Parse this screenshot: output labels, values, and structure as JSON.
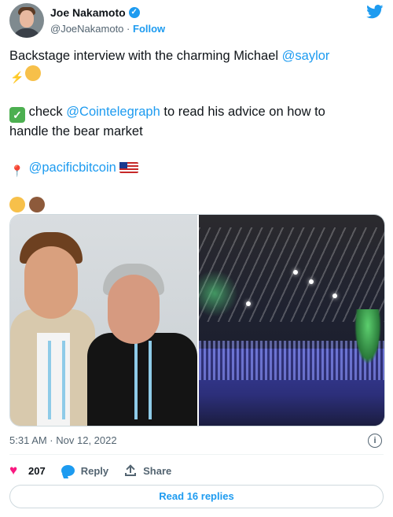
{
  "author": {
    "name": "Joe Nakamoto",
    "handle": "@JoeNakamoto",
    "separator": "·",
    "follow_label": "Follow"
  },
  "icons": {
    "verified": "verified-badge-icon",
    "brand": "twitter-bird-icon",
    "info": "info-icon",
    "like": "heart-icon",
    "reply": "reply-bubble-icon",
    "share": "share-icon"
  },
  "tweet": {
    "line1_text": "Backstage interview with the charming Michael ",
    "line1_mention": "@saylor",
    "line3_text_a": " check ",
    "line3_mention": "@Cointelegraph",
    "line3_text_b": " to read his advice on how to",
    "line4_text": "handle the bear market",
    "line5_mention": "@pacificbitcoin"
  },
  "media": {
    "left_image": "selfie-backstage",
    "right_image": "conference-hall"
  },
  "meta": {
    "timestamp": "5:31 AM · Nov 12, 2022",
    "info_glyph": "i"
  },
  "actions": {
    "like_count": "207",
    "reply_label": "Reply",
    "share_label": "Share"
  },
  "footer": {
    "read_replies": "Read 16 replies"
  },
  "colors": {
    "link": "#1d9bf0",
    "like": "#f91880",
    "muted": "#536471",
    "text": "#0f1419"
  }
}
